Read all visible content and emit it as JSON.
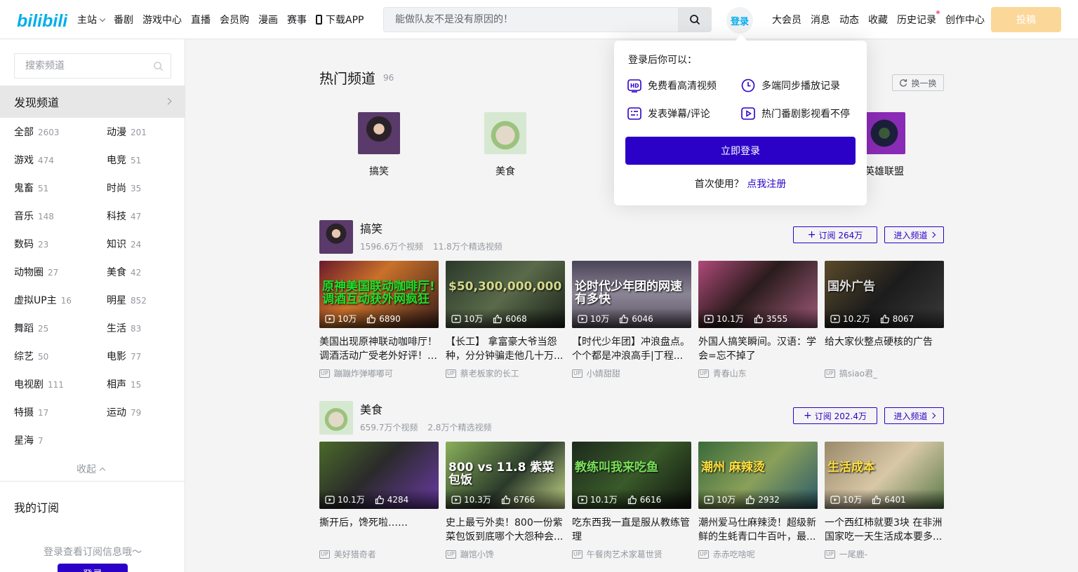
{
  "colors": {
    "accent": "#2b00c7",
    "brand": "#00aeec",
    "post": "#fbd89a"
  },
  "header": {
    "logo": "bilibili",
    "nav": [
      "主站",
      "番剧",
      "游戏中心",
      "直播",
      "会员购",
      "漫画",
      "赛事",
      "下载APP"
    ],
    "search_placeholder": "能做队友不是没有原因的！",
    "login": "登录",
    "right_nav": [
      "大会员",
      "消息",
      "动态",
      "收藏",
      "历史记录",
      "创作中心"
    ],
    "post": "投稿"
  },
  "sidebar": {
    "search_placeholder": "搜索频道",
    "discover": "发现频道",
    "categories": [
      {
        "name": "全部",
        "count": "2603"
      },
      {
        "name": "动漫",
        "count": "201"
      },
      {
        "name": "游戏",
        "count": "474"
      },
      {
        "name": "电竞",
        "count": "51"
      },
      {
        "name": "鬼畜",
        "count": "51"
      },
      {
        "name": "时尚",
        "count": "35"
      },
      {
        "name": "音乐",
        "count": "148"
      },
      {
        "name": "科技",
        "count": "47"
      },
      {
        "name": "数码",
        "count": "23"
      },
      {
        "name": "知识",
        "count": "24"
      },
      {
        "name": "动物圈",
        "count": "27"
      },
      {
        "name": "美食",
        "count": "42"
      },
      {
        "name": "虚拟UP主",
        "count": "16"
      },
      {
        "name": "明星",
        "count": "852"
      },
      {
        "name": "舞蹈",
        "count": "25"
      },
      {
        "name": "生活",
        "count": "83"
      },
      {
        "name": "综艺",
        "count": "50"
      },
      {
        "name": "电影",
        "count": "77"
      },
      {
        "name": "电视剧",
        "count": "111"
      },
      {
        "name": "相声",
        "count": "15"
      },
      {
        "name": "特摄",
        "count": "17"
      },
      {
        "name": "运动",
        "count": "79"
      },
      {
        "name": "星海",
        "count": "7"
      }
    ],
    "collapse": "收起",
    "my_sub": "我的订阅",
    "login_hint": "登录查看订阅信息哦～",
    "login_btn": "登录"
  },
  "hot": {
    "title": "热门频道",
    "count": "96",
    "refresh": "换一换",
    "items": [
      "搞笑",
      "美食",
      "英雄联盟"
    ]
  },
  "popup": {
    "title": "登录后你可以：",
    "items": [
      "免费看高清视频",
      "多端同步播放记录",
      "发表弹幕/评论",
      "热门番剧影视看不停"
    ],
    "button": "立即登录",
    "register_prefix": "首次使用？",
    "register_link": "点我注册"
  },
  "sections": [
    {
      "name": "搞笑",
      "videos_stat": "1596.6万个视频",
      "featured_stat": "11.8万个精选视频",
      "subscribe": "订阅 264万",
      "enter": "进入频道",
      "videos": [
        {
          "views": "10万",
          "likes": "6890",
          "title": "美国出现原神联动咖啡厅！调酒活动广受老外好评！网友：...",
          "up": "蹦蹦炸弹嘟嘟可",
          "thumb_text": "原神美国联动咖啡厅!调酒互动获外网疯狂"
        },
        {
          "views": "10万",
          "likes": "6068",
          "title": "【长工】 拿富豪大爷当怨种，分分钟骗走他几十万...",
          "up": "蔡老板家的长工",
          "thumb_text": "$50,300,000,000"
        },
        {
          "views": "10万",
          "likes": "6046",
          "title": "【时代少年团】冲浪盘点。个个都是冲浪高手|丁程...",
          "up": "小婧甜甜",
          "thumb_text": "论时代少年团的网速有多快"
        },
        {
          "views": "10.1万",
          "likes": "3555",
          "title": "外国人搞笑瞬间。汉语：学会=忘不掉了",
          "up": "青春山东",
          "thumb_text": ""
        },
        {
          "views": "10.2万",
          "likes": "8067",
          "title": "给大家伙整点硬核的广告",
          "up": "搞siao君_",
          "thumb_text": "国外广告"
        }
      ]
    },
    {
      "name": "美食",
      "videos_stat": "659.7万个视频",
      "featured_stat": "2.8万个精选视频",
      "subscribe": "订阅 202.4万",
      "enter": "进入频道",
      "videos": [
        {
          "views": "10.1万",
          "likes": "4284",
          "title": "撕开后，馋死啦……",
          "up": "美好猎奇者",
          "thumb_text": ""
        },
        {
          "views": "10.3万",
          "likes": "6766",
          "title": "史上最亏外卖！800一份紫菜包饭到底哪个大怨种会...",
          "up": "蹦馆小馋",
          "thumb_text": "800 vs 11.8 紫菜包饭"
        },
        {
          "views": "10.1万",
          "likes": "6616",
          "title": "吃东西我一直是服从教练管理",
          "up": "午餐肉艺术家葛世贤",
          "thumb_text": "教练叫我来吃鱼"
        },
        {
          "views": "10万",
          "likes": "2932",
          "title": "潮州爱马仕麻辣烫！超级新鲜的生蚝青口牛百叶，最...",
          "up": "赤赤吃啥呢",
          "thumb_text": "潮州 麻辣烫"
        },
        {
          "views": "10万",
          "likes": "6401",
          "title": "一个西红柿就要3块 在非洲国家吃一天生活成本要多...",
          "up": "一尾鹿-",
          "thumb_text": "生活成本"
        }
      ]
    }
  ]
}
